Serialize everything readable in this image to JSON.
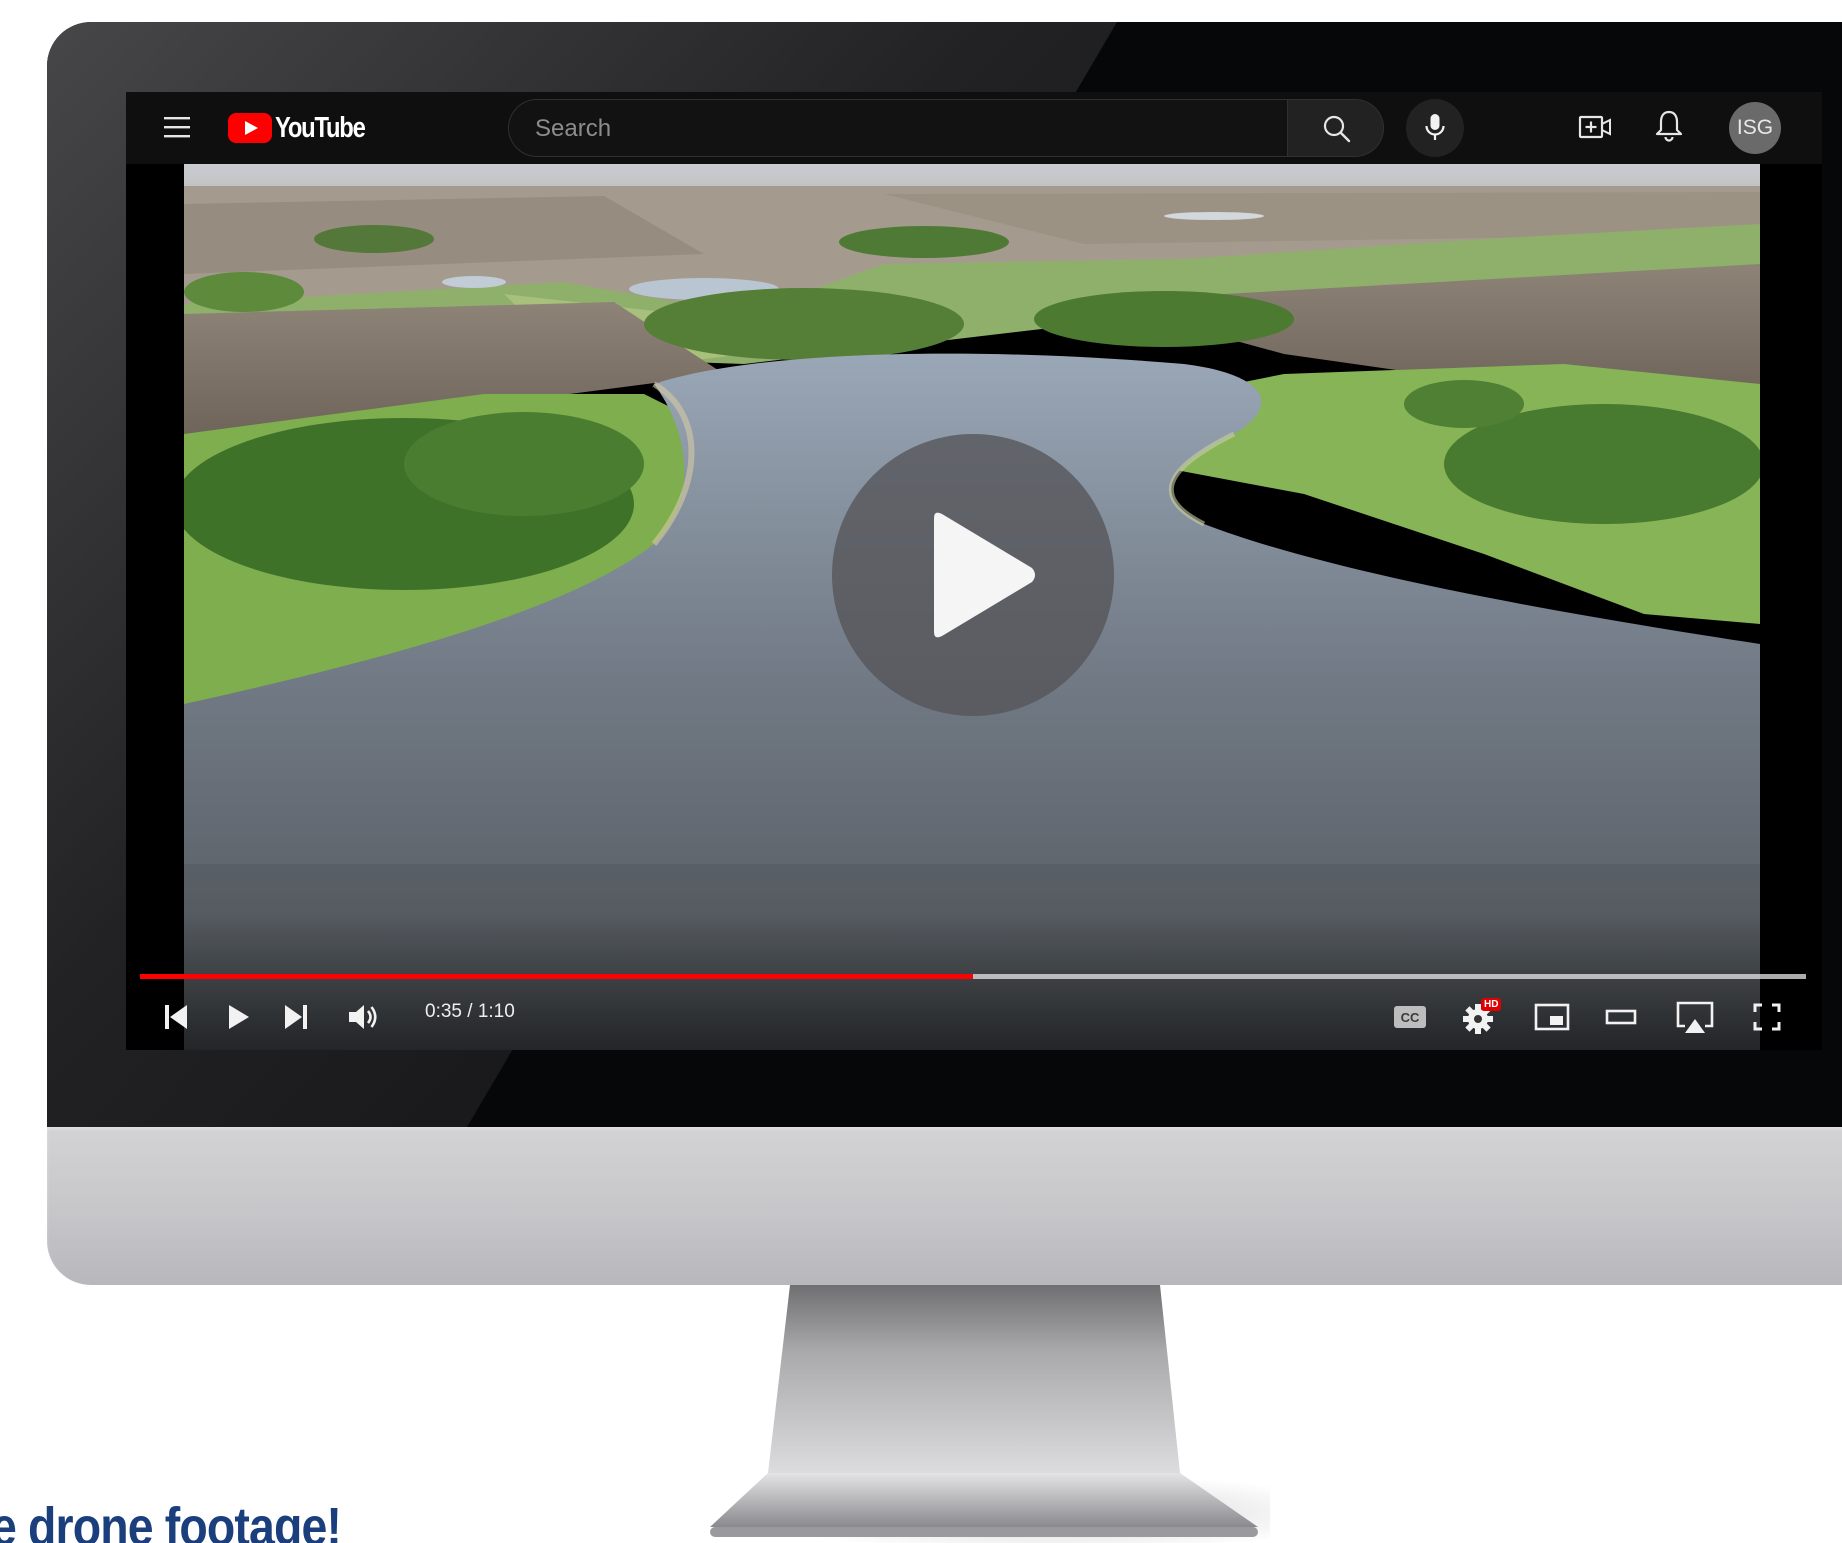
{
  "app": {
    "logo_text": "YouTube",
    "brand_color": "#ff0000"
  },
  "search": {
    "placeholder": "Search"
  },
  "icons": {
    "menu": "menu-icon",
    "search": "search-icon",
    "mic": "microphone-icon",
    "create": "create-video-icon",
    "notifications": "bell-icon"
  },
  "account": {
    "avatar_initials": "ISG"
  },
  "player": {
    "current_time": "0:35",
    "duration": "1:10",
    "time_display": "0:35 / 1:10",
    "progress_fraction": 0.5,
    "progress_color": "#ff0000",
    "settings_badge": "HD",
    "state": "paused"
  },
  "caption": {
    "text": "e drone footage!",
    "color": "#1b3f7c"
  }
}
